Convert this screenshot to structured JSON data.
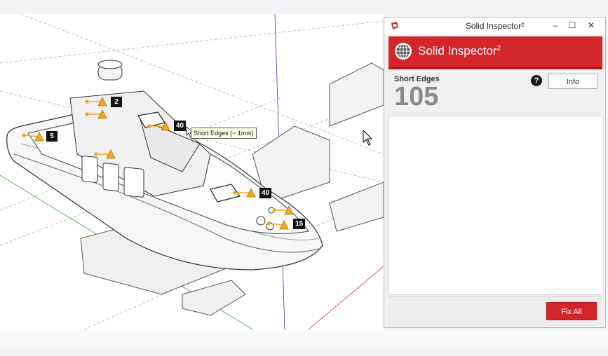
{
  "window": {
    "title": "Solid Inspector²",
    "minimize_glyph": "–",
    "maximize_glyph": "☐",
    "close_glyph": "✕"
  },
  "header": {
    "title": "Solid Inspector",
    "title_sup": "2",
    "color": "#d2262b"
  },
  "result": {
    "label": "Short Edges",
    "count": "105",
    "help_glyph": "?",
    "info_label": "Info"
  },
  "footer": {
    "fix_all_label": "Fix All",
    "accent": "#d2262b"
  },
  "viewport": {
    "tooltip": "Short Edges (~ 1mm)",
    "markers": [
      "2",
      "5",
      "40",
      "40",
      "15"
    ],
    "warning_color": "#f5a623"
  },
  "icons": {
    "app": "sketchup-icon",
    "logo": "globe-logo-icon",
    "warning": "warning-triangle-icon",
    "cursor": "mouse-cursor-icon"
  }
}
